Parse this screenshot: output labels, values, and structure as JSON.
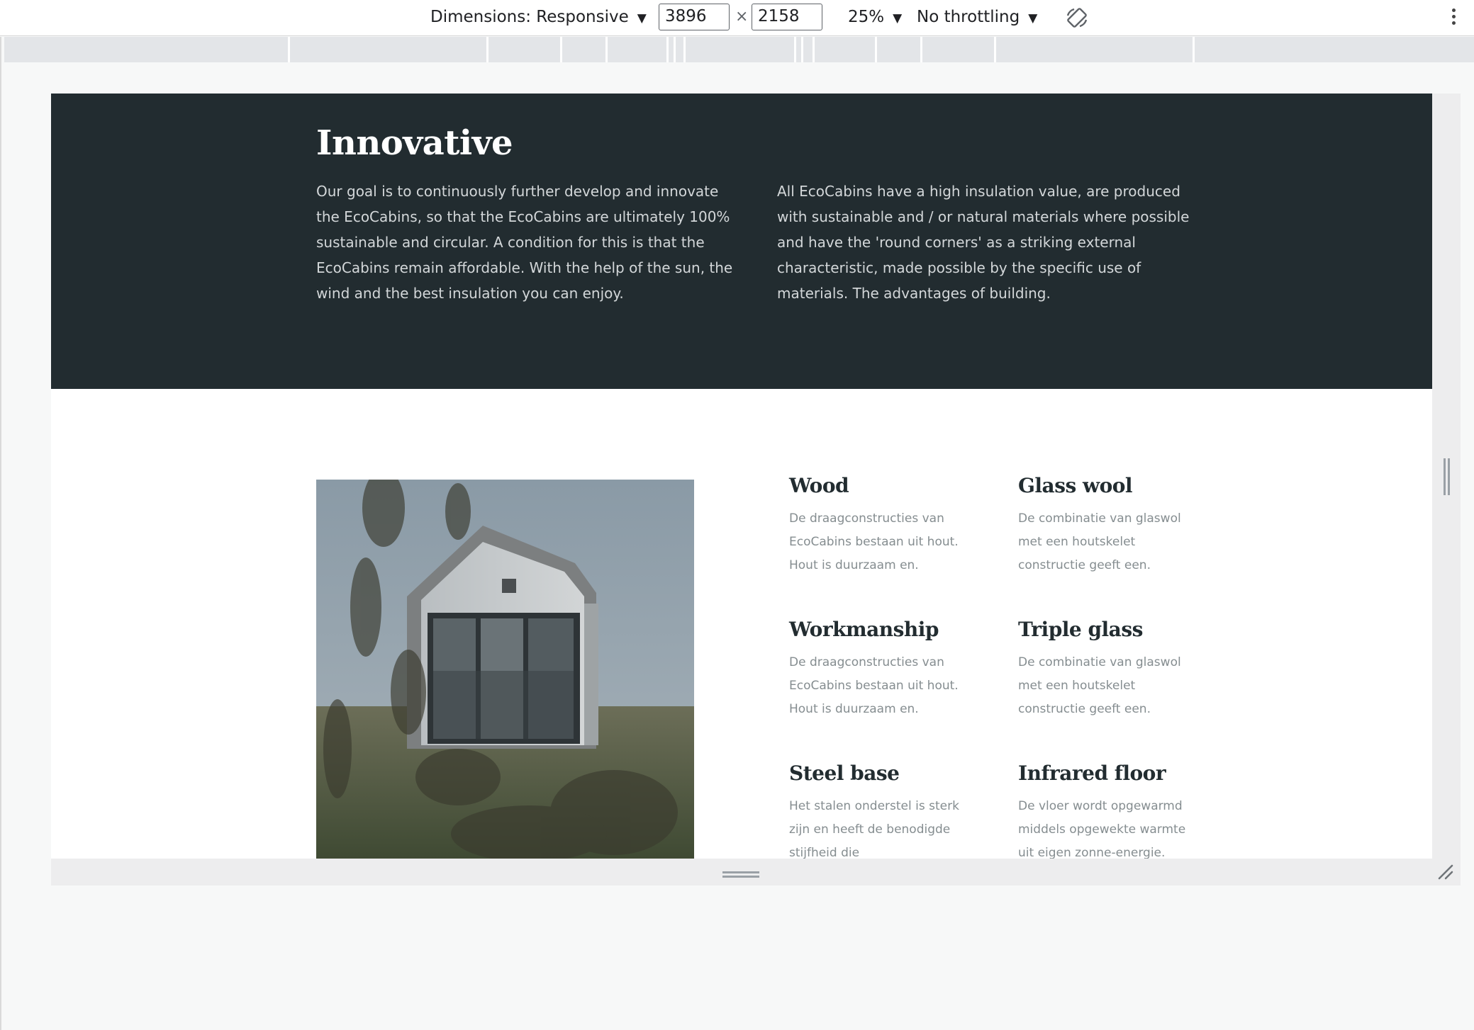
{
  "devtools": {
    "dimensions_label": "Dimensions: Responsive",
    "width_value": "3896",
    "height_value": "2158",
    "times": "×",
    "zoom": "25%",
    "throttling": "No throttling",
    "caret": "▼"
  },
  "page": {
    "heading": "Innovative",
    "paragraph_left": "Our goal is to continuously further develop and innovate the EcoCabins, so that the EcoCabins are ultimately 100% sustainable and circular. A condition for this is that the EcoCabins remain affordable. With the help of the sun, the wind and the best insulation you can enjoy.",
    "paragraph_right": "All EcoCabins have a high insulation value, are produced with sustainable and / or natural materials where possible and have the 'round corners' as a striking external characteristic, made possible by the specific use of materials. The advantages of building.",
    "features": [
      {
        "title": "Wood",
        "desc": "De draagconstructies van EcoCabins bestaan uit hout. Hout is duurzaam en."
      },
      {
        "title": "Glass wool",
        "desc": "De combinatie van glaswol met een houtskelet constructie geeft een."
      },
      {
        "title": "Workmanship",
        "desc": "De draagconstructies van EcoCabins bestaan uit hout. Hout is duurzaam en."
      },
      {
        "title": "Triple glass",
        "desc": "De combinatie van glaswol met een houtskelet constructie geeft een."
      },
      {
        "title": "Steel base",
        "desc": "Het stalen onderstel is sterk zijn en heeft de benodigde stijfheid die"
      },
      {
        "title": "Infrared floor",
        "desc": "De vloer wordt opgewarmd middels opgewekte warmte uit eigen zonne-energie."
      }
    ]
  },
  "colors": {
    "band": "#222c30",
    "heading_on_dark": "#ffffff",
    "feature_title": "#222c30",
    "feature_text": "#858d90"
  }
}
